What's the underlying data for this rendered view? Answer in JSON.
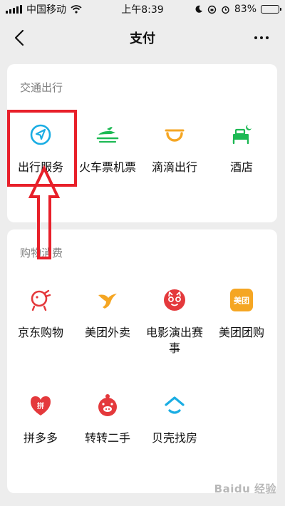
{
  "status_bar": {
    "carrier": "中国移动",
    "time": "上午8:39",
    "battery": "83%",
    "battery_level": 0.83
  },
  "nav": {
    "title": "支付",
    "back_icon": "chevron-left-icon",
    "more_icon": "more-dots-icon"
  },
  "sections": [
    {
      "title": "交通出行",
      "items": [
        {
          "label": "出行服务",
          "icon": "navigation-arrow-icon",
          "color": "#1aade3"
        },
        {
          "label": "火车票机票",
          "icon": "train-plane-icon",
          "color": "#1db954"
        },
        {
          "label": "滴滴出行",
          "icon": "didi-icon",
          "color": "#f5a623"
        },
        {
          "label": "酒店",
          "icon": "hotel-bed-icon",
          "color": "#1db954"
        }
      ]
    },
    {
      "title": "购物消费",
      "items": [
        {
          "label": "京东购物",
          "icon": "jd-dog-icon",
          "color": "#e4393c"
        },
        {
          "label": "美团外卖",
          "icon": "kangaroo-icon",
          "color": "#f5a623"
        },
        {
          "label": "电影演出赛事",
          "icon": "cat-eye-icon",
          "color": "#e4393c"
        },
        {
          "label": "美团团购",
          "icon": "meituan-logo-icon",
          "color": "#f5a623",
          "icon_text": "美团"
        },
        {
          "label": "拼多多",
          "icon": "pinduoduo-heart-icon",
          "color": "#e4393c",
          "icon_text": "拼"
        },
        {
          "label": "转转二手",
          "icon": "zhuanzhuan-pig-icon",
          "color": "#e4393c"
        },
        {
          "label": "贝壳找房",
          "icon": "beike-house-icon",
          "color": "#1aade3"
        }
      ]
    }
  ],
  "annotation_color": "#e8202a",
  "watermark": "Baidu 经验"
}
